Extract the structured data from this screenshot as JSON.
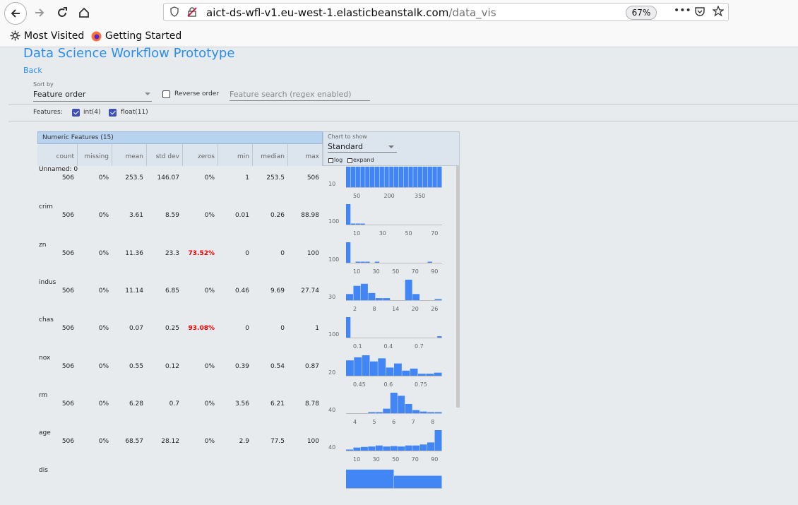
{
  "browser": {
    "url_host": "aict-ds-wfl-v1.eu-west-1.elasticbeanstalk.com",
    "url_path": "/data_vis",
    "zoom": "67%",
    "bookmarks": [
      "Most Visited",
      "Getting Started"
    ]
  },
  "app": {
    "title": "Data Science Workflow Prototype",
    "back": "Back",
    "sort_by_label": "Sort by",
    "sort_by_value": "Feature order",
    "reverse_order": "Reverse order",
    "search_placeholder": "Feature search (regex enabled)",
    "features_label": "Features:",
    "filters": [
      "int(4)",
      "float(11)"
    ]
  },
  "table": {
    "header": "Numeric Features (15)",
    "columns": [
      "count",
      "missing",
      "mean",
      "std dev",
      "zeros",
      "min",
      "median",
      "max"
    ],
    "chart_label": "Chart to show",
    "chart_value": "Standard",
    "log_label": "log",
    "expand_label": "expand",
    "rows": [
      {
        "name": "Unnamed: 0",
        "values": [
          "506",
          "0%",
          "253.5",
          "146.07",
          "0%",
          "1",
          "253.5",
          "506"
        ],
        "zeros_red": false,
        "ylabel": "10",
        "ticks": [
          "50",
          "200",
          "350"
        ],
        "bars": [
          1,
          1,
          1,
          1,
          1,
          1,
          1,
          1,
          1,
          1,
          1,
          1,
          1,
          1,
          1,
          1,
          1,
          1,
          1,
          1
        ]
      },
      {
        "name": "crim",
        "values": [
          "506",
          "0%",
          "3.61",
          "8.59",
          "0%",
          "0.01",
          "0.26",
          "88.98"
        ],
        "zeros_red": false,
        "ylabel": "100",
        "ticks": [
          "10",
          "30",
          "50",
          "70"
        ],
        "bars": [
          1,
          0.04,
          0.01,
          0.01,
          0,
          0,
          0,
          0,
          0,
          0,
          0,
          0,
          0,
          0,
          0,
          0,
          0,
          0,
          0,
          0
        ]
      },
      {
        "name": "zn",
        "values": [
          "506",
          "0%",
          "11.36",
          "23.3",
          "73.52%",
          "0",
          "0",
          "100"
        ],
        "zeros_red": true,
        "ylabel": "100",
        "ticks": [
          "10",
          "30",
          "50",
          "70",
          "90"
        ],
        "bars": [
          1,
          0,
          0.05,
          0.02,
          0.02,
          0,
          0.01,
          0,
          0,
          0,
          0,
          0,
          0,
          0,
          0,
          0,
          0,
          0.04,
          0,
          0
        ]
      },
      {
        "name": "indus",
        "values": [
          "506",
          "0%",
          "11.14",
          "6.85",
          "0%",
          "0.46",
          "9.69",
          "27.74"
        ],
        "zeros_red": false,
        "ylabel": "30",
        "ticks": [
          "2",
          "8",
          "14",
          "20",
          "26"
        ],
        "bars": [
          0.3,
          0.7,
          0.8,
          0.35,
          0.1,
          0.1,
          0,
          0,
          1,
          0.3,
          0,
          0,
          0.05
        ]
      },
      {
        "name": "chas",
        "values": [
          "506",
          "0%",
          "0.07",
          "0.25",
          "93.08%",
          "0",
          "0",
          "1"
        ],
        "zeros_red": true,
        "ylabel": "100",
        "ticks": [
          "0.1",
          "0.4",
          "0.7"
        ],
        "bars": [
          1,
          0,
          0,
          0,
          0,
          0,
          0,
          0,
          0,
          0,
          0,
          0,
          0,
          0,
          0,
          0,
          0,
          0,
          0,
          0.07
        ]
      },
      {
        "name": "nox",
        "values": [
          "506",
          "0%",
          "0.55",
          "0.12",
          "0%",
          "0.39",
          "0.54",
          "0.87"
        ],
        "zeros_red": false,
        "ylabel": "20",
        "ticks": [
          "0.45",
          "0.6",
          "0.75"
        ],
        "bars": [
          0.75,
          0.9,
          1,
          0.7,
          0.85,
          0.4,
          0.6,
          0.25,
          0.35,
          0.1,
          0.1,
          0.15
        ]
      },
      {
        "name": "rm",
        "values": [
          "506",
          "0%",
          "6.28",
          "0.7",
          "0%",
          "3.56",
          "6.21",
          "8.78"
        ],
        "zeros_red": false,
        "ylabel": "40",
        "ticks": [
          "4",
          "5",
          "6",
          "7",
          "8"
        ],
        "bars": [
          0,
          0,
          0,
          0.03,
          0.05,
          0.22,
          1,
          0.85,
          0.45,
          0.15,
          0.08,
          0.05,
          0.02
        ]
      },
      {
        "name": "age",
        "values": [
          "506",
          "0%",
          "68.57",
          "28.12",
          "0%",
          "2.9",
          "77.5",
          "100"
        ],
        "zeros_red": false,
        "ylabel": "40",
        "ticks": [
          "10",
          "30",
          "50",
          "70",
          "90"
        ],
        "bars": [
          0.05,
          0.15,
          0.18,
          0.2,
          0.25,
          0.2,
          0.22,
          0.2,
          0.25,
          0.25,
          0.3,
          0.4,
          1
        ]
      },
      {
        "name": "dis",
        "values": [],
        "zeros_red": false,
        "ylabel": "",
        "ticks": [],
        "bars": [
          0.9,
          0.6
        ]
      }
    ]
  },
  "colors": {
    "link": "#2a8ef0",
    "bar": "#4285f4",
    "red": "#e00000"
  }
}
